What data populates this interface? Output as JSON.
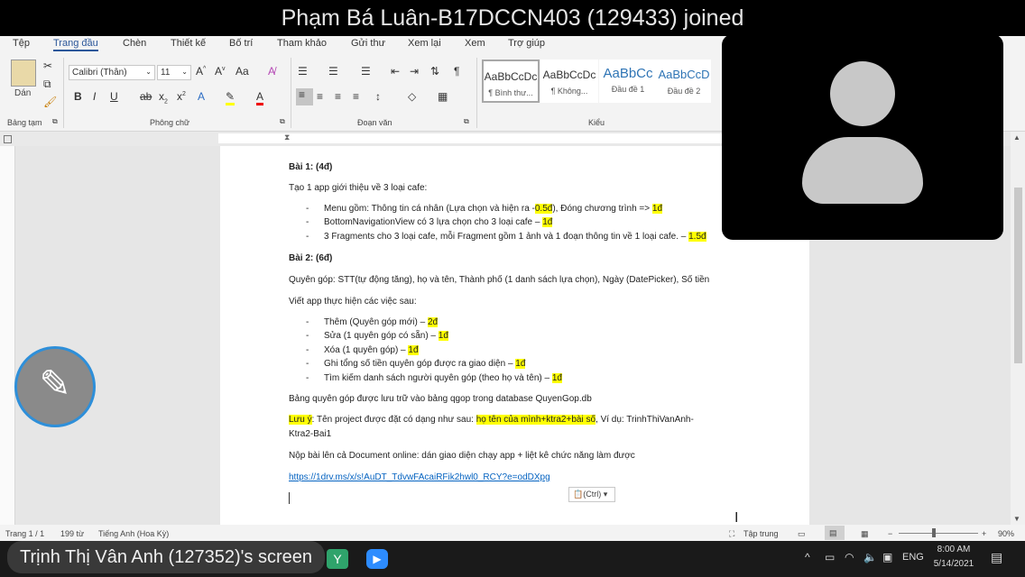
{
  "top_banner": {
    "text": "Phạm Bá Luân-B17DCCN403 (129433) joined"
  },
  "menu": {
    "items": [
      "Tệp",
      "Trang đầu",
      "Chèn",
      "Thiết kế",
      "Bố trí",
      "Tham khảo",
      "Gửi thư",
      "Xem lại",
      "Xem",
      "Trợ giúp"
    ],
    "active": "Trang đầu"
  },
  "ribbon": {
    "clipboard": {
      "paste": "Dán",
      "group": "Bảng tạm"
    },
    "font": {
      "name": "Calibri (Thân)",
      "size": "11",
      "group": "Phông chữ",
      "bold": "B",
      "italic": "I",
      "underline": "U",
      "case": "Aa"
    },
    "paragraph": {
      "group": "Đoạn văn"
    },
    "styles": {
      "group": "Kiểu",
      "items": [
        {
          "preview": "AaBbCcDc",
          "name": "¶ Bình thư..."
        },
        {
          "preview": "AaBbCcDc",
          "name": "¶ Không..."
        },
        {
          "preview": "AaBbCc",
          "name": "Đầu đề 1"
        },
        {
          "preview": "AaBbCcD",
          "name": "Đầu đề 2"
        }
      ]
    }
  },
  "document": {
    "bai1_title": "Bài 1: (4đ)",
    "bai1_intro": "Tạo 1 app giới thiệu về 3 loại cafe:",
    "b1_item1_pre": "Menu gồm: Thông tin cá nhân (Lựa chọn và hiện ra -",
    "b1_item1_hl": "0.5đ",
    "b1_item1_mid": "), Đóng chương trình => ",
    "b1_item1_hl2": "1đ",
    "b1_item2_pre": "BottomNavigationView có 3 lựa chọn cho 3 loại cafe – ",
    "b1_item2_hl": "1đ",
    "b1_item3_pre": "3 Fragments cho 3 loại cafe, mỗi Fragment gồm 1 ảnh và 1 đoạn thông tin về 1 loại cafe. – ",
    "b1_item3_hl": "1.5đ",
    "bai2_title": "Bài 2: (6đ)",
    "bai2_fields": "Quyên góp: STT(tự động tăng), họ và tên, Thành phố (1 danh sách lựa chọn), Ngày (DatePicker), Số tiền",
    "bai2_intro": "Viết app thực hiện các việc sau:",
    "b2_items": [
      {
        "text": "Thêm (Quyên góp mới) – ",
        "hl": "2đ"
      },
      {
        "text": "Sửa (1 quyên góp có sẵn) – ",
        "hl": "1đ"
      },
      {
        "text": "Xóa (1 quyên góp) – ",
        "hl": "1đ"
      },
      {
        "text": "Ghi tổng số tiền quyên góp được ra giao diện – ",
        "hl": "1đ"
      },
      {
        "text": "Tìm kiếm danh sách người quyên góp (theo họ và tên) – ",
        "hl": "1đ"
      }
    ],
    "db_line": "Bảng quyên góp được lưu trữ vào bảng qgop trong database QuyenGop.db",
    "note_label": "Lưu ý",
    "note_pre": ": Tên project được đặt có dạng như sau: ",
    "note_hl": "họ tên của mình+ktra2+bài số",
    "note_post": ", Ví dụ: TrinhThiVanAnh-",
    "note_line2": "Ktra2-Bai1",
    "submit_line": "Nộp bài lên cả Document online: dán giao diện chạy app + liệt kê chức năng làm được",
    "link": "https://1drv.ms/x/s!AuDT_TdvwFAcaiRFik2hwl0_RCY?e=odDXpg",
    "paste_ctrl": "(Ctrl)"
  },
  "status": {
    "page": "Trang 1 / 1",
    "words": "199 từ",
    "lang": "Tiếng Anh (Hoa Kỳ)",
    "focus": "Tập trung",
    "zoom": "90%"
  },
  "taskbar": {
    "lang": "ENG",
    "time": "8:00 AM",
    "date": "5/14/2021"
  },
  "overlay": {
    "screen_label": "Trịnh Thị Vân Anh (127352)'s screen"
  }
}
